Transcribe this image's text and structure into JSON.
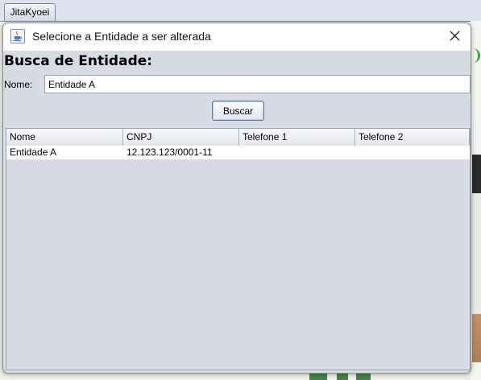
{
  "background_app": {
    "tab_label": "JitaKyoei"
  },
  "dialog": {
    "title": "Selecione a Entidade a ser alterada",
    "app_icon": "java-cup-icon",
    "close_icon": "close-icon"
  },
  "search": {
    "heading": "Busca de Entidade:",
    "name_label": "Nome:",
    "name_value": "Entidade A",
    "button_label": "Buscar"
  },
  "table": {
    "columns": [
      "Nome",
      "CNPJ",
      "Telefone 1",
      "Telefone 2"
    ],
    "rows": [
      [
        "Entidade A",
        "12.123.123/0001-11",
        "",
        ""
      ]
    ]
  },
  "colors": {
    "dialog_bg": "#d8dbe3",
    "accent_border": "#5f7ea6"
  }
}
